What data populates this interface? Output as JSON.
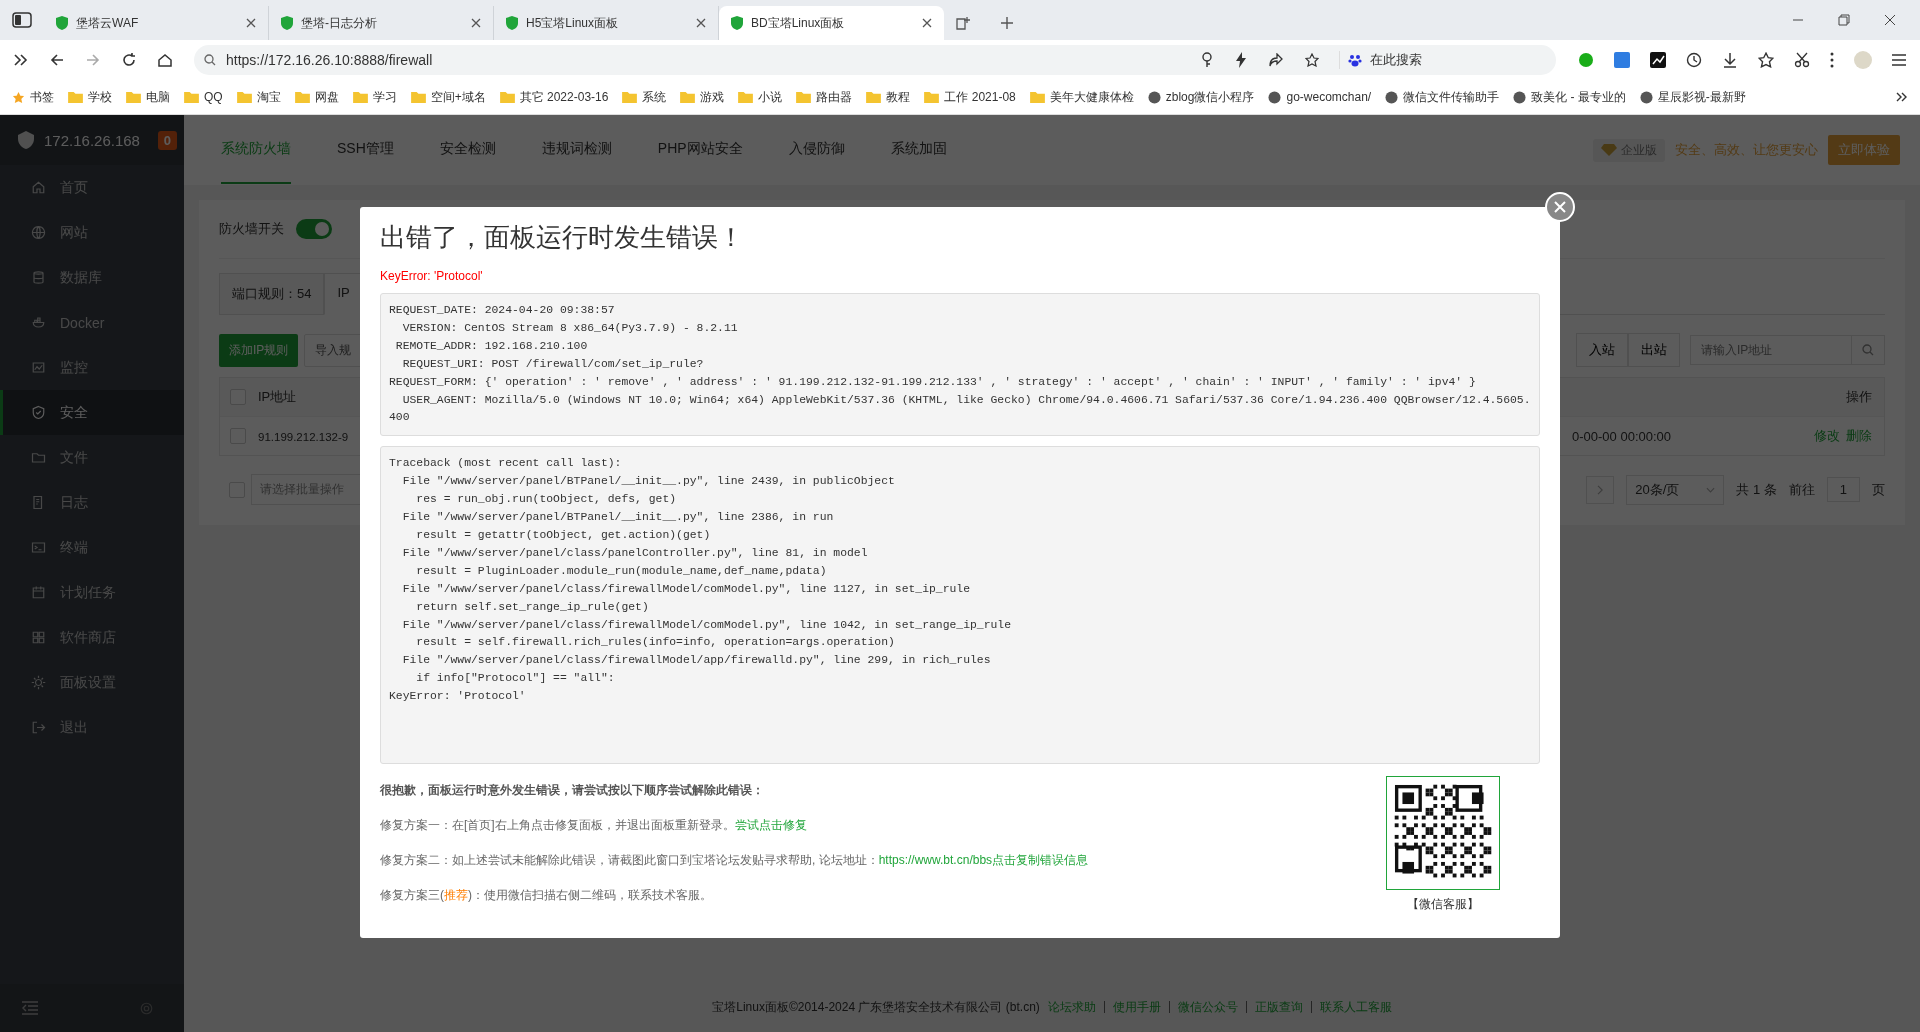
{
  "browser": {
    "tabs": [
      {
        "title": "堡塔云WAF",
        "selected": false
      },
      {
        "title": "堡塔-日志分析",
        "selected": false
      },
      {
        "title": "H5宝塔Linux面板",
        "selected": false
      },
      {
        "title": "BD宝塔Linux面板",
        "selected": true
      }
    ],
    "url": "https://172.16.26.10:8888/firewall",
    "search_placeholder": "在此搜索",
    "bookmarks": [
      {
        "label": "书签",
        "kind": "star"
      },
      {
        "label": "学校",
        "kind": "folder"
      },
      {
        "label": "电脑",
        "kind": "folder"
      },
      {
        "label": "QQ",
        "kind": "folder"
      },
      {
        "label": "淘宝",
        "kind": "folder"
      },
      {
        "label": "网盘",
        "kind": "folder"
      },
      {
        "label": "学习",
        "kind": "folder"
      },
      {
        "label": "空间+域名",
        "kind": "folder"
      },
      {
        "label": "其它 2022-03-16",
        "kind": "folder"
      },
      {
        "label": "系统",
        "kind": "folder"
      },
      {
        "label": "游戏",
        "kind": "folder"
      },
      {
        "label": "小说",
        "kind": "folder"
      },
      {
        "label": "路由器",
        "kind": "folder"
      },
      {
        "label": "教程",
        "kind": "folder"
      },
      {
        "label": "工作 2021-08",
        "kind": "folder"
      },
      {
        "label": "美年大健康体检",
        "kind": "folder"
      },
      {
        "label": "zblog微信小程序",
        "kind": "site"
      },
      {
        "label": "go-wecomchan/",
        "kind": "site"
      },
      {
        "label": "微信文件传输助手",
        "kind": "site"
      },
      {
        "label": "致美化 - 最专业的",
        "kind": "site"
      },
      {
        "label": "星辰影视-最新野",
        "kind": "site"
      }
    ]
  },
  "sidebar": {
    "host": "172.16.26.168",
    "badge": "0",
    "items": [
      {
        "label": "首页",
        "selected": false
      },
      {
        "label": "网站",
        "selected": false
      },
      {
        "label": "数据库",
        "selected": false
      },
      {
        "label": "Docker",
        "selected": false
      },
      {
        "label": "监控",
        "selected": false
      },
      {
        "label": "安全",
        "selected": true
      },
      {
        "label": "文件",
        "selected": false
      },
      {
        "label": "日志",
        "selected": false
      },
      {
        "label": "终端",
        "selected": false
      },
      {
        "label": "计划任务",
        "selected": false
      },
      {
        "label": "软件商店",
        "selected": false
      },
      {
        "label": "面板设置",
        "selected": false
      },
      {
        "label": "退出",
        "selected": false
      }
    ]
  },
  "top_tabs": [
    {
      "label": "系统防火墙",
      "selected": true
    },
    {
      "label": "SSH管理",
      "selected": false
    },
    {
      "label": "安全检测",
      "selected": false
    },
    {
      "label": "违规词检测",
      "selected": false
    },
    {
      "label": "PHP网站安全",
      "selected": false
    },
    {
      "label": "入侵防御",
      "selected": false
    },
    {
      "label": "系统加固",
      "selected": false
    }
  ],
  "promo": {
    "badge": "企业版",
    "text": "安全、高效、让您更安心",
    "button": "立即体验"
  },
  "firewall": {
    "switch_label": "防火墙开关",
    "on": true,
    "rule_tabs": [
      {
        "label": "端口规则：54",
        "selected": false
      },
      {
        "label": "IP",
        "selected": true
      }
    ],
    "buttons": [
      "添加IP规则",
      "导入规"
    ],
    "direction_tabs": [
      {
        "label": "入站",
        "selected": false
      },
      {
        "label": "出站",
        "selected": false
      }
    ],
    "search_placeholder": "请输入IP地址",
    "header_checked": false,
    "batch_checked": false,
    "table": {
      "columns": [
        "IP地址",
        "操作"
      ],
      "rows": [
        {
          "checked": false,
          "ip": "91.199.212.132-9",
          "time": "0-00-00 00:00:00",
          "actions": [
            "修改",
            "删除"
          ]
        }
      ]
    },
    "batch_placeholder": "请选择批量操作",
    "pagination": {
      "page_size": "20条/页",
      "total": "共 1 条",
      "goto": "前往",
      "page": "1",
      "unit": "页"
    }
  },
  "footer": {
    "text": "宝塔Linux面板©2014-2024 广东堡塔安全技术有限公司 (bt.cn)",
    "links": [
      "论坛求助",
      "使用手册",
      "微信公众号",
      "正版查询",
      "联系人工客服"
    ]
  },
  "dialog": {
    "title": "出错了，面板运行时发生错误！",
    "error": "KeyError: 'Protocol'",
    "request_lines": [
      "REQUEST_DATE: 2024-04-20 09:38:57",
      "  VERSION: CentOS Stream 8 x86_64(Py3.7.9) - 8.2.11",
      " REMOTE_ADDR: 192.168.210.100",
      "  REQUEST_URI: POST /firewall/com/set_ip_rule?",
      "REQUEST_FORM: {' operation' : ' remove' , ' address' : ' 91.199.212.132-91.199.212.133' , ' strategy' : ' accept' , ' chain' : ' INPUT' , ' family' : ' ipv4' }",
      "  USER_AGENT: Mozilla/5.0 (Windows NT 10.0; Win64; x64) AppleWebKit/537.36 (KHTML, like Gecko) Chrome/94.0.4606.71 Safari/537.36 Core/1.94.236.400 QQBrowser/12.4.5605.400"
    ],
    "traceback_lines": [
      "Traceback (most recent call last):",
      "  File \"/www/server/panel/BTPanel/__init__.py\", line 2439, in publicObject",
      "    res = run_obj.run(toObject, defs, get)",
      "  File \"/www/server/panel/BTPanel/__init__.py\", line 2386, in run",
      "    result = getattr(toObject, get.action)(get)",
      "  File \"/www/server/panel/class/panelController.py\", line 81, in model",
      "    result = PluginLoader.module_run(module_name,def_name,pdata)",
      "  File \"/www/server/panel/class/firewallModel/comModel.py\", line 1127, in set_ip_rule",
      "    return self.set_range_ip_rule(get)",
      "  File \"/www/server/panel/class/firewallModel/comModel.py\", line 1042, in set_range_ip_rule",
      "    result = self.firewall.rich_rules(info=info, operation=args.operation)",
      "  File \"/www/server/panel/class/firewallModel/app/firewalld.py\", line 299, in rich_rules",
      "    if info[\"Protocol\"] == \"all\":",
      "KeyError: 'Protocol'"
    ],
    "help_heading": "很抱歉，面板运行时意外发生错误，请尝试按以下顺序尝试解除此错误：",
    "fixes": [
      {
        "kind": "link",
        "text": "修复方案一：在[首页]右上角点击修复面板，并退出面板重新登录。",
        "link": "尝试点击修复"
      },
      {
        "kind": "link",
        "text": "修复方案二：如上述尝试未能解除此错误，请截图此窗口到宝塔论坛发贴寻求帮助, 论坛地址：",
        "link": "https://www.bt.cn/bbs点击复制错误信息"
      },
      {
        "kind": "highlight",
        "prefix": "修复方案三(",
        "highlight": "推荐",
        "suffix": ")：使用微信扫描右侧二维码，联系技术客服。"
      }
    ],
    "qr_caption": "【微信客服】"
  }
}
